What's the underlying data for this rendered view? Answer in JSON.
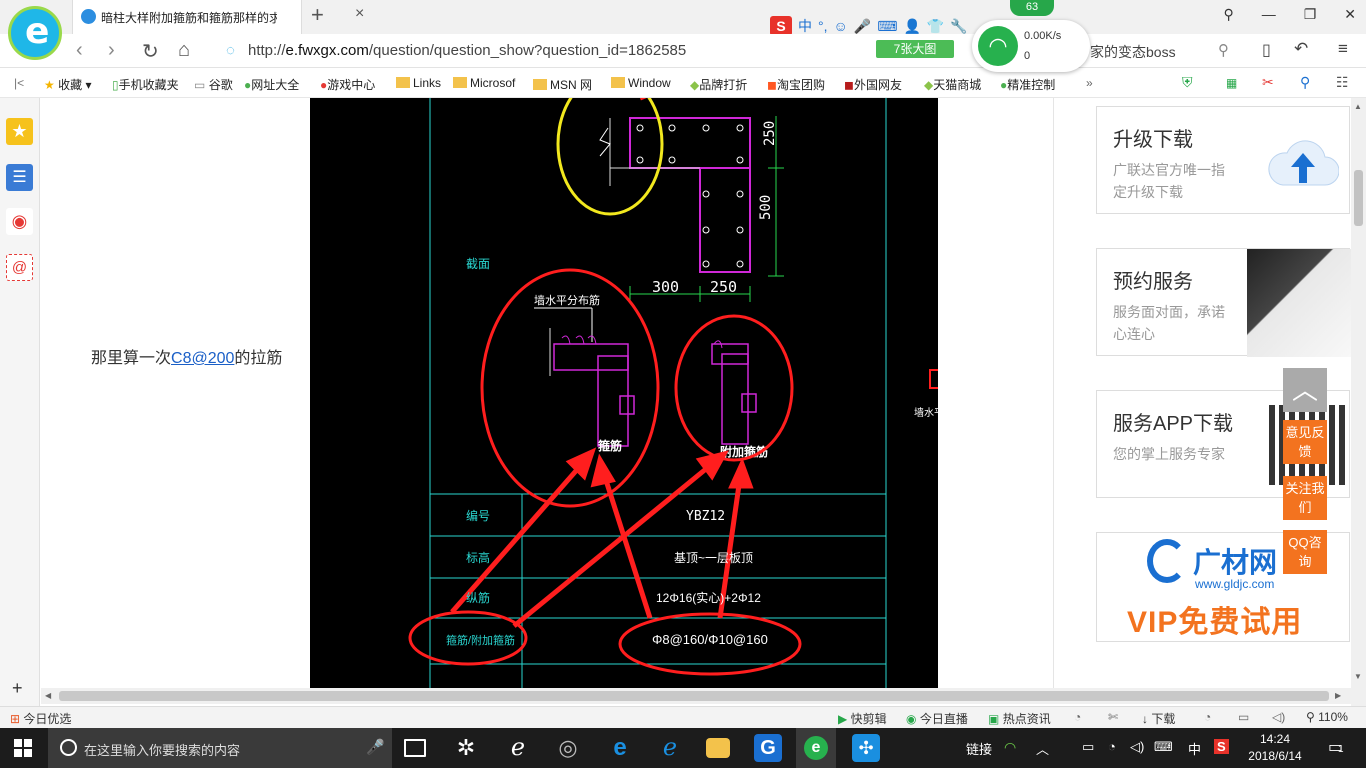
{
  "browser": {
    "tab_title": "暗柱大样附加箍筋和箍筋那样的求",
    "tab_close": "×",
    "new_tab": "+",
    "url_prefix": "http://",
    "url_host": "e.fwxgx.com",
    "url_path": "/question/question_show?question_id=1862585",
    "big_image_button": "7张大图",
    "search_hint": "家的变态boss",
    "network_badge": "63",
    "network_speed": "0.00K/s",
    "network_count": "0",
    "ime_label": "中"
  },
  "bookmarks": [
    {
      "label": "收藏"
    },
    {
      "label": "手机收藏夹"
    },
    {
      "label": "谷歌"
    },
    {
      "label": "网址大全"
    },
    {
      "label": "游戏中心"
    },
    {
      "label": "Links"
    },
    {
      "label": "Microsof"
    },
    {
      "label": "MSN 网"
    },
    {
      "label": "Window"
    },
    {
      "label": "品牌打折"
    },
    {
      "label": "淘宝团购"
    },
    {
      "label": "外国网友"
    },
    {
      "label": "天猫商城"
    },
    {
      "label": "精准控制"
    }
  ],
  "content": {
    "text_before": "那里算一次",
    "link_text": "C8@200",
    "text_after": "的拉筋"
  },
  "cad": {
    "dim_250a": "250",
    "dim_500": "500",
    "dim_300": "300",
    "dim_250b": "250",
    "section_label": "截面",
    "horizontal_label": "墙水平分布筋",
    "stirrup_label": "箍筋",
    "extra_stirrup_label": "附加箍筋",
    "row_number_label": "编号",
    "row_number_value": "YBZ12",
    "row_elev_label": "标高",
    "row_elev_value": "基顶~一层板顶",
    "row_rebar_label": "纵筋",
    "row_rebar_value": "12Φ16(实心)+2Φ12",
    "row_stirrup_label": "箍筋/附加箍筋",
    "row_stirrup_value": "Φ8@160/Φ10@160",
    "side_label": "墙水平"
  },
  "sidebar_cards": [
    {
      "title": "升级下载",
      "subtitle": "广联达官方唯一指定升级下载"
    },
    {
      "title": "预约服务",
      "subtitle": "服务面对面，承诺心连心"
    },
    {
      "title": "服务APP下载",
      "subtitle": "您的掌上服务专家"
    }
  ],
  "ad": {
    "brand": "广材网",
    "url": "www.gldjc.com",
    "slogan": "VIP免费试用"
  },
  "float_buttons": {
    "feedback": "意见反馈",
    "follow": "关注我们",
    "qq": "QQ咨询"
  },
  "statusbar": {
    "left": "今日优选",
    "kuaijian": "快剪辑",
    "live": "今日直播",
    "news": "热点资讯",
    "download": "下载",
    "zoom": "110%"
  },
  "taskbar": {
    "search_placeholder": "在这里输入你要搜索的内容",
    "link_label": "链接",
    "ime": "中",
    "time": "14:24",
    "date": "2018/6/14",
    "notification_count": "1"
  },
  "colors": {
    "accent_green": "#27b14e",
    "cad_red": "#ff1e1e",
    "cad_magenta": "#d028d8",
    "cad_cyan": "#2ad6d0",
    "float_orange": "#f3731f"
  }
}
